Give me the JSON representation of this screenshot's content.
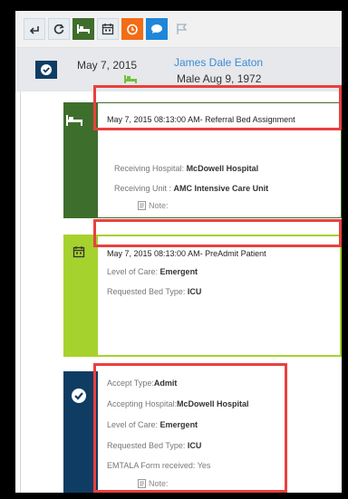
{
  "header": {
    "date": "May 7, 2015",
    "patient_name": "James Dale Eaton",
    "patient_info": "Male Aug 9, 1972"
  },
  "colors": {
    "dark_green": "#3e6e2c",
    "lime": "#a6d22d",
    "navy": "#0f3c63",
    "orange": "#f36c16",
    "blue": "#1f86d8",
    "highlight": "#e8413f"
  },
  "toolbar": {
    "icons": [
      "back-arrow-icon",
      "refresh-icon",
      "bed-icon",
      "calendar-icon",
      "alarm-clock-icon",
      "chat-bubble-icon",
      "flag-icon"
    ]
  },
  "cards": [
    {
      "title": "May 7, 2015 08:13:00 AM- Referral Bed Assignment",
      "icon": "bed-icon",
      "lines": [
        {
          "label": "Receiving Hospital:",
          "value": "McDowell Hospital"
        },
        {
          "label": "Receiving Unit :",
          "value": "AMC Intensive Care Unit"
        }
      ],
      "note": "Note:"
    },
    {
      "title": "May 7, 2015 08:13:00 AM- PreAdmit Patient",
      "icon": "calendar-icon",
      "lines": [
        {
          "label": "Level of Care:",
          "value": "Emergent"
        },
        {
          "label": "Requested Bed Type:",
          "value": "ICU"
        }
      ]
    },
    {
      "icon": "check-icon",
      "lines": [
        {
          "label": "Accept Type:",
          "value": "Admit"
        },
        {
          "label": "Accepting Hospital:",
          "value": "McDowell Hospital"
        },
        {
          "label": "Level of Care:",
          "value": "Emergent"
        },
        {
          "label": "Requested Bed Type:",
          "value": "ICU"
        },
        {
          "label": "EMTALA Form received:",
          "value": "Yes"
        }
      ],
      "note": "Note:"
    }
  ]
}
